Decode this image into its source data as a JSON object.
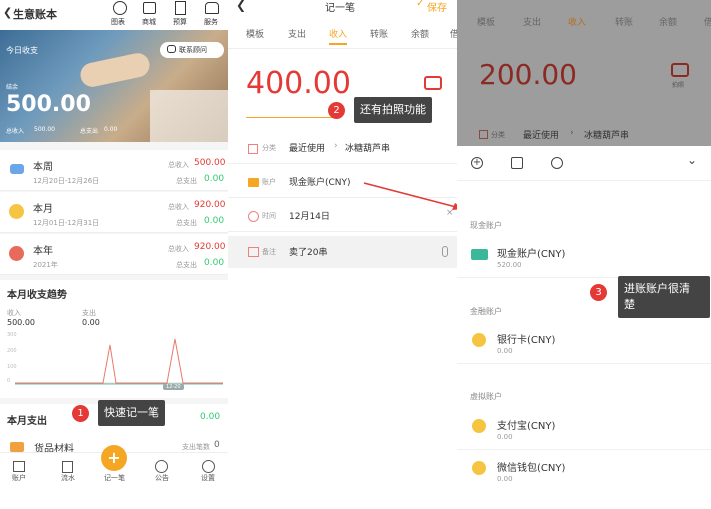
{
  "pane1": {
    "title": "生意账本",
    "header_icons": [
      "图表",
      "商城",
      "预算",
      "服务"
    ],
    "banner": {
      "label": "今日收支",
      "service": "联系顾问",
      "amount": "500.00",
      "amount_prefix": "结余",
      "sub_in_label": "总收入",
      "sub_in": "500.00",
      "sub_out_label": "总支出",
      "sub_out": "0.00"
    },
    "periods": [
      {
        "name": "本周",
        "range": "12月20日-12月26日",
        "in_label": "总收入",
        "in": "500.00",
        "out_label": "总支出",
        "out": "0.00"
      },
      {
        "name": "本月",
        "range": "12月01日-12月31日",
        "in_label": "总收入",
        "in": "920.00",
        "out_label": "总支出",
        "out": "0.00"
      },
      {
        "name": "本年",
        "range": "2021年",
        "in_label": "总收入",
        "in": "920.00",
        "out_label": "总支出",
        "out": "0.00"
      }
    ],
    "trend": {
      "title": "本月收支趋势",
      "in_label": "收入",
      "in_value": "500.00",
      "out_label": "支出",
      "out_value": "0.00",
      "y_ticks": [
        "300",
        "200",
        "100",
        "0"
      ],
      "highlight": "12-20"
    },
    "month_spend": {
      "title": "本月支出",
      "value": "0.00",
      "item": "货品材料",
      "item_note": "支出笔数",
      "item_count": "0"
    },
    "nav": [
      "账户",
      "流水",
      "记一笔",
      "公告",
      "设置"
    ],
    "nav_center": "+",
    "callout_num": "1",
    "callout": "快速记一笔"
  },
  "pane2": {
    "title": "记一笔",
    "save": "保存",
    "tabs": [
      "模板",
      "支出",
      "收入",
      "转账",
      "余额",
      "借"
    ],
    "active_tab": "收入",
    "amount": "400.00",
    "fields": [
      {
        "label": "分类",
        "hint": "最近使用",
        "value": "冰糖葫芦串"
      },
      {
        "label": "账户",
        "value": "现金账户(CNY)"
      },
      {
        "label": "时间",
        "value": "12月14日"
      },
      {
        "label": "备注",
        "value": "卖了20串"
      }
    ],
    "callout_num": "2",
    "callout": "还有拍照功能"
  },
  "pane3": {
    "tabs": [
      "模板",
      "支出",
      "收入",
      "转账",
      "余额",
      "借"
    ],
    "amount": "200.00",
    "photo_label": "拍照",
    "category_label": "分类",
    "category_hint": "最近使用",
    "category_value": "冰糖葫芦串",
    "groups": [
      {
        "title": "现金账户",
        "items": [
          {
            "name": "现金账户(CNY)",
            "value": "520.00"
          }
        ]
      },
      {
        "title": "金融账户",
        "items": [
          {
            "name": "银行卡(CNY)",
            "value": "0.00"
          }
        ]
      },
      {
        "title": "虚拟账户",
        "items": [
          {
            "name": "支付宝(CNY)",
            "value": "0.00"
          },
          {
            "name": "微信钱包(CNY)",
            "value": "0.00"
          }
        ]
      }
    ],
    "callout_num": "3",
    "callout_line1": "进账账户很清",
    "callout_line2": "楚"
  },
  "colors": {
    "accent": "#f5a623",
    "red": "#e53935",
    "green": "#2ecc71"
  }
}
